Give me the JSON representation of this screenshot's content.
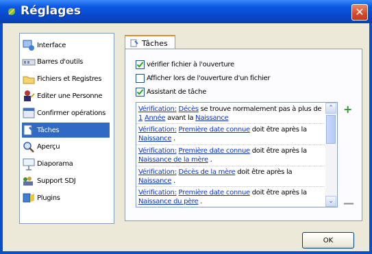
{
  "window": {
    "title": "Réglages",
    "title_icon": "leaf-icon",
    "close_glyph": "✕"
  },
  "sidebar": {
    "items": [
      {
        "label": "Interface",
        "icon": "interface-icon"
      },
      {
        "label": "Barres d'outils",
        "icon": "toolbar-icon"
      },
      {
        "label": "Fichiers et Registres",
        "icon": "folder-icon"
      },
      {
        "label": "Editer une Personne",
        "icon": "person-icon"
      },
      {
        "label": "Confirmer opérations",
        "icon": "confirm-icon"
      },
      {
        "label": "Tâches",
        "icon": "tasks-icon",
        "selected": true
      },
      {
        "label": "Aperçu",
        "icon": "preview-icon"
      },
      {
        "label": "Diaporama",
        "icon": "slideshow-icon"
      },
      {
        "label": "Support SDJ",
        "icon": "support-icon"
      },
      {
        "label": "Plugins",
        "icon": "plugins-icon"
      }
    ]
  },
  "tab": {
    "label": "Tâches",
    "icon": "tasks-icon"
  },
  "options": [
    {
      "label": "vérifier fichier à l'ouverture",
      "checked": true
    },
    {
      "label": "Afficher lors de l'ouverture d'un fichier",
      "checked": false
    },
    {
      "label": "Assistant de tâche",
      "checked": true
    }
  ],
  "rules": [
    {
      "parts": [
        {
          "t": "k",
          "v": "Vérification:"
        },
        {
          "t": "s",
          "v": " "
        },
        {
          "t": "l",
          "v": "Décès"
        },
        {
          "t": "s",
          "v": " se trouve normalement pas à plus de "
        },
        {
          "t": "l",
          "v": "1"
        },
        {
          "t": "s",
          "v": " "
        },
        {
          "t": "l",
          "v": "Année"
        },
        {
          "t": "s",
          "v": " avant la "
        },
        {
          "t": "l",
          "v": "Naissance"
        }
      ]
    },
    {
      "parts": [
        {
          "t": "k",
          "v": "Vérification:"
        },
        {
          "t": "s",
          "v": " "
        },
        {
          "t": "l",
          "v": "Première date connue"
        },
        {
          "t": "s",
          "v": " doit être après la "
        },
        {
          "t": "l",
          "v": "Naissance"
        },
        {
          "t": "s",
          "v": " ."
        }
      ]
    },
    {
      "parts": [
        {
          "t": "k",
          "v": "Vérification:"
        },
        {
          "t": "s",
          "v": " "
        },
        {
          "t": "l",
          "v": "Première date connue"
        },
        {
          "t": "s",
          "v": " doit être après la "
        },
        {
          "t": "l",
          "v": "Naissance de la mère"
        },
        {
          "t": "s",
          "v": " ."
        }
      ]
    },
    {
      "parts": [
        {
          "t": "k",
          "v": "Vérification:"
        },
        {
          "t": "s",
          "v": " "
        },
        {
          "t": "l",
          "v": "Décès de la mère"
        },
        {
          "t": "s",
          "v": " doit être après la "
        },
        {
          "t": "l",
          "v": "Naissance"
        },
        {
          "t": "s",
          "v": " ."
        }
      ]
    },
    {
      "parts": [
        {
          "t": "k",
          "v": "Vérification:"
        },
        {
          "t": "s",
          "v": " "
        },
        {
          "t": "l",
          "v": "Première date connue"
        },
        {
          "t": "s",
          "v": " doit être après la "
        },
        {
          "t": "l",
          "v": "Naissance du père"
        },
        {
          "t": "s",
          "v": " ."
        }
      ]
    }
  ],
  "buttons": {
    "add": "+",
    "remove": "—",
    "ok": "OK",
    "scroll_up": "⌃",
    "scroll_down": "⌄"
  }
}
